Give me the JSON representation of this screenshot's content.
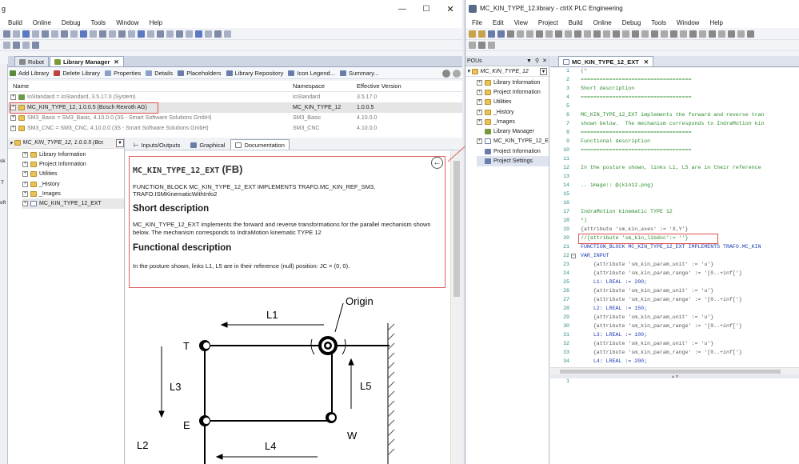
{
  "left": {
    "title_frag": "g",
    "menu": [
      "Build",
      "Online",
      "Debug",
      "Tools",
      "Window",
      "Help"
    ],
    "sidebar_frag": [
      "sk",
      "T",
      "oft"
    ],
    "tabs": [
      {
        "label": "Robot"
      },
      {
        "label": "Library Manager"
      }
    ],
    "actions": [
      "Add Library",
      "Delete Library",
      "Properties",
      "Details",
      "Placeholders",
      "Library Repository",
      "Icon Legend...",
      "Summary..."
    ],
    "columns": [
      "Name",
      "Namespace",
      "Effective Version"
    ],
    "libs": [
      {
        "name": "IoStandard = IoStandard, 3.5.17.0 (System)",
        "ns": "IoStandard",
        "ver": "3.5.17.0"
      },
      {
        "name": "MC_KIN_TYPE_12, 1.0.0.5 (Bosch Rexroth AG)",
        "ns": "MC_KIN_TYPE_12",
        "ver": "1.0.0.5"
      },
      {
        "name": "SM3_Basic = SM3_Basic, 4.10.0.0 (3S - Smart Software Solutions GmbH)",
        "ns": "SM3_Basic",
        "ver": "4.10.0.0"
      },
      {
        "name": "SM3_CNC = SM3_CNC, 4.10.0.0 (3S - Smart Software Solutions GmbH)",
        "ns": "SM3_CNC",
        "ver": "4.10.0.0"
      }
    ],
    "tree_root": "MC_KIN_TYPE_12, 1.0.0.5 (Bosch",
    "tree": [
      "Library Information",
      "Project Information",
      "Utilities",
      "_History",
      "_Images",
      "MC_KIN_TYPE_12_EXT"
    ],
    "doc_tabs": [
      "Inputs/Outputs",
      "Graphical",
      "Documentation"
    ],
    "doc": {
      "title": "MC_KIN_TYPE_12_EXT",
      "title_suffix": "(FB)",
      "decl": "FUNCTION_BLOCK MC_KIN_TYPE_12_EXT IMPLEMENTS TRAFO.MC_KIN_REF_SM3, TRAFO.ISMKinematicWithInfo2",
      "h_short": "Short description",
      "p_short": "MC_KIN_TYPE_12_EXT implements the forward and reverse transformations for the parallel mechanism shown below. The mechanism corresponds to IndraMotion kinematic TYPE 12",
      "h_func": "Functional description",
      "p_func": "In the posture shown, links L1, L5 are in their reference (null) position: JC = (0, 0)."
    },
    "diagram": {
      "origin": "Origin",
      "L1": "L1",
      "L2": "L2",
      "L3": "L3",
      "L4": "L4",
      "L5": "L5",
      "T": "T",
      "E": "E",
      "W": "W"
    }
  },
  "right": {
    "title": "MC_KIN_TYPE_12.library - ctrlX PLC Engineering",
    "menu": [
      "File",
      "Edit",
      "View",
      "Project",
      "Build",
      "Online",
      "Debug",
      "Tools",
      "Window",
      "Help"
    ],
    "pous_title": "POUs",
    "pou_root": "MC_KIN_TYPE_12",
    "pou_tree": [
      "Library Information",
      "Project Information",
      "Utilities",
      "_History",
      "_Images",
      "Library Manager",
      "MC_KIN_TYPE_12_E",
      "Project Information",
      "Project Settings"
    ],
    "editor_tab": "MC_KIN_TYPE_12_EXT",
    "code": [
      {
        "n": "1",
        "t": "(*",
        "c": "cm"
      },
      {
        "n": "2",
        "t": "===================================",
        "c": "cm"
      },
      {
        "n": "3",
        "t": "Short description",
        "c": "cm"
      },
      {
        "n": "4",
        "t": "===================================",
        "c": "cm"
      },
      {
        "n": "5",
        "t": "",
        "c": "cm"
      },
      {
        "n": "6",
        "t": "MC_KIN_TYPE_12_EXT implements the forward and reverse tran",
        "c": "cm"
      },
      {
        "n": "7",
        "t": "shown below.  The mechanism corresponds to IndraMotion kin",
        "c": "cm"
      },
      {
        "n": "8",
        "t": "===================================",
        "c": "cm"
      },
      {
        "n": "9",
        "t": "Functional description",
        "c": "cm"
      },
      {
        "n": "10",
        "t": "===================================",
        "c": "cm"
      },
      {
        "n": "11",
        "t": "",
        "c": "cm"
      },
      {
        "n": "12",
        "t": "In the posture shown, links L1, L5 are in their reference",
        "c": "cm"
      },
      {
        "n": "13",
        "t": "",
        "c": "cm"
      },
      {
        "n": "14",
        "t": ".. image:: @(kin12.png)",
        "c": "cm"
      },
      {
        "n": "15",
        "t": "",
        "c": "cm"
      },
      {
        "n": "16",
        "t": "",
        "c": "cm"
      },
      {
        "n": "17",
        "t": "IndraMotion kinematic TYPE 12",
        "c": "cm"
      },
      {
        "n": "18",
        "t": "*)",
        "c": "cm"
      },
      {
        "n": "19",
        "t": "{attribute 'sm_kin_axes' := 'X,Y'}",
        "c": "at"
      },
      {
        "n": "20",
        "t": "//{attribute 'sm_kin_libdoc':= ''}",
        "c": "cm"
      },
      {
        "n": "21",
        "t": "FUNCTION_BLOCK MC_KIN_TYPE_12_EXT IMPLEMENTS TRAFO.MC_KIN",
        "c": "kw"
      },
      {
        "n": "22",
        "t": "VAR_INPUT",
        "c": "kw"
      },
      {
        "n": "23",
        "t": "    {attribute 'sm_kin_param_unit' := 'u'}",
        "c": "at"
      },
      {
        "n": "24",
        "t": "    {attribute 'sm_kin_param_range' := '[0..+inf['}",
        "c": "at"
      },
      {
        "n": "25",
        "t": "    L1: LREAL := 200;",
        "c": "kw"
      },
      {
        "n": "26",
        "t": "    {attribute 'sm_kin_param_unit' := 'u'}",
        "c": "at"
      },
      {
        "n": "27",
        "t": "    {attribute 'sm_kin_param_range' := '[0..+inf['}",
        "c": "at"
      },
      {
        "n": "28",
        "t": "    L2: LREAL := 150;",
        "c": "kw"
      },
      {
        "n": "29",
        "t": "    {attribute 'sm_kin_param_unit' := 'u'}",
        "c": "at"
      },
      {
        "n": "30",
        "t": "    {attribute 'sm_kin_param_range' := '[0..+inf['}",
        "c": "at"
      },
      {
        "n": "31",
        "t": "    L3: LREAL := 100;",
        "c": "kw"
      },
      {
        "n": "32",
        "t": "    {attribute 'sm_kin_param_unit' := 'u'}",
        "c": "at"
      },
      {
        "n": "33",
        "t": "    {attribute 'sm_kin_param_range' := '[0..+inf['}",
        "c": "at"
      },
      {
        "n": "34",
        "t": "    L4: LREAL := 200;",
        "c": "kw"
      }
    ],
    "decl_line": "1"
  }
}
